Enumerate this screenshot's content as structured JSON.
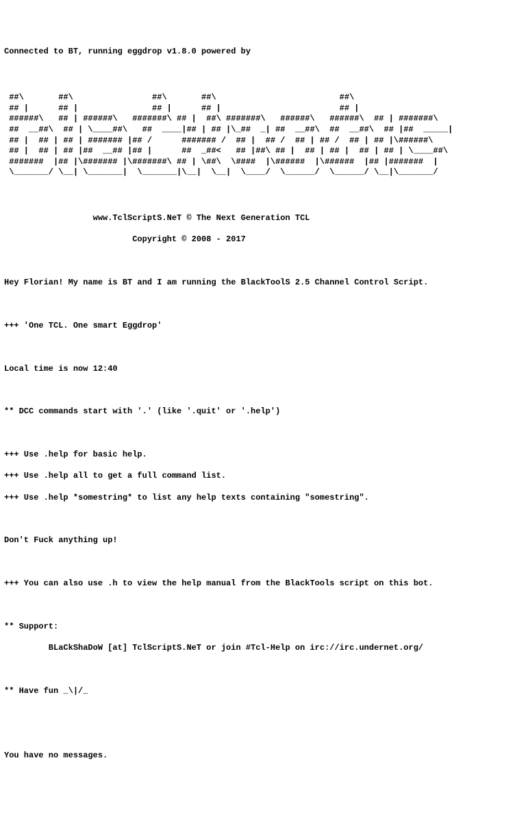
{
  "header": "Connected to BT, running eggdrop v1.8.0 powered by",
  "ascii_art": " ##\\       ##\\                ##\\       ##\\                         ##\\\n ## |      ## |               ## |      ## |                        ## |\n ######\\   ## | ######\\   #######\\ ## |  ##\\ #######\\   ######\\   ######\\  ## | #######\\\n ##  __##\\  ## | \\____##\\   ##  ____|## | ## |\\_##  _| ##  __##\\  ##  __##\\  ## |##  _____|\n ## |  ## | ## | ####### |## /      ####### /  ## |  ## /  ## | ## /  ## | ## |\\######\\\n ## |  ## | ## |##  __## |## |      ##  _##<   ## |##\\ ## |  ## | ## |  ## | ## | \\____##\\\n #######  |## |\\####### |\\#######\\ ## | \\##\\  \\####  |\\######  |\\######  |## |#######  |\n \\_______/ \\__| \\_______|  \\_______|\\__|  \\__|  \\____/  \\______/  \\______/ \\__|\\_______/",
  "site_line": "www.TclScriptS.NeT © The Next Generation TCL",
  "copyright": "Copyright © 2008 - 2017",
  "greeting": "Hey Florian! My name is BT and I am running the BlackToolS 2.5 Channel Control Script.",
  "tagline": "+++ 'One TCL. One smart Eggdrop'",
  "localtime": "Local time is now 12:40",
  "dcc_hint": "** DCC commands start with '.' (like '.quit' or '.help')",
  "help1": "+++ Use .help for basic help.",
  "help2": "+++ Use .help all to get a full command list.",
  "help3": "+++ Use .help *somestring* to list any help texts containing \"somestring\".",
  "warning": "Don't Fuck anything up!",
  "help_manual": "+++ You can also use .h to view the help manual from the BlackTools script on this bot.",
  "support_label": "** Support:",
  "support_info": "         BLaCkShaDoW [at] TclScriptS.NeT or join #Tcl-Help on irc://irc.undernet.org/",
  "have_fun": "** Have fun _\\|/_",
  "messages": "You have no messages."
}
